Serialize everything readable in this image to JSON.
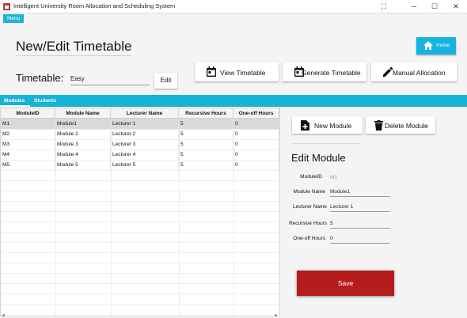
{
  "window": {
    "title": "Intelligent University Room Allocation and Scheduling System",
    "controls": {
      "extra": "⛶",
      "minimize": "─",
      "maximize": "☐",
      "close": "✕"
    }
  },
  "menubar": {
    "menu_label": "Menu"
  },
  "header": {
    "page_title": "New/Edit Timetable",
    "home_label": "Home",
    "timetable_label": "Timetable:",
    "timetable_value": "Easy",
    "edit_label": "Edit",
    "actions": {
      "view": "View Timetable",
      "generate": "Generate Timetable",
      "manual": "Manual Allocation"
    }
  },
  "tabs": {
    "modules": "Modules",
    "students": "Students"
  },
  "table": {
    "columns": [
      "ModuleID",
      "Module Name",
      "Lecturer Name",
      "Recursive Hours",
      "One-off Hours"
    ],
    "rows": [
      [
        "M1",
        "Module1",
        "Lecturer 1",
        "5",
        "0"
      ],
      [
        "M2",
        "Module 2",
        "Lecturer 2",
        "5",
        "0"
      ],
      [
        "M3",
        "Module 3",
        "Lecturer 3",
        "5",
        "0"
      ],
      [
        "M4",
        "Module 4",
        "Lecturer 4",
        "5",
        "0"
      ],
      [
        "M5",
        "Module 5",
        "Lecturer 5",
        "5",
        "0"
      ]
    ]
  },
  "side_panel": {
    "new_module": "New Module",
    "delete_module": "Delete Module",
    "edit_title": "Edit Module",
    "form": {
      "module_id_label": "ModuleID",
      "module_id_value": "M1",
      "module_name_label": "Module Name",
      "module_name_value": "Module1",
      "lecturer_name_label": "Lecturer Name",
      "lecturer_name_value": "Lecturer 1",
      "recursive_hours_label": "Recursive Hours",
      "recursive_hours_value": "5",
      "oneoff_hours_label": "One-off Hours",
      "oneoff_hours_value": "0"
    },
    "save_label": "Save"
  },
  "colors": {
    "accent": "#16b3d6",
    "home_button": "#16b3e2",
    "save_button": "#b71c1c"
  },
  "icons": [
    "app-icon",
    "home-icon",
    "calendar-icon",
    "pencil-icon",
    "add-document-icon",
    "trash-icon"
  ]
}
